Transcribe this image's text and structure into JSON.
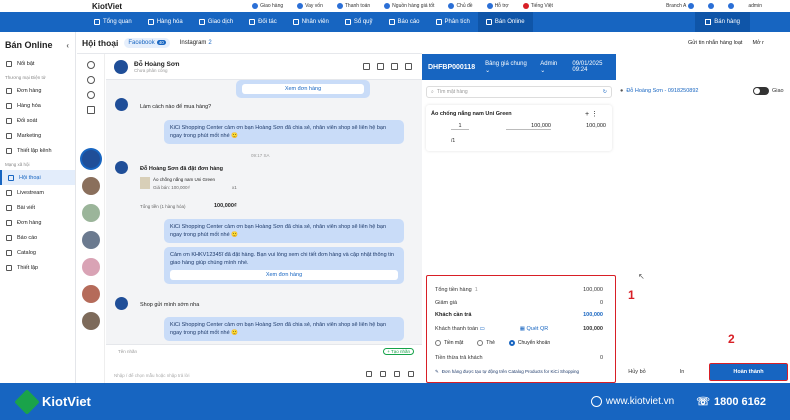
{
  "topbar": {
    "logo": "KiotViet",
    "items": [
      "Giao hàng",
      "Vay vốn",
      "Thanh toán",
      "Nguồn hàng giá tốt",
      "Chủ đề",
      "Hỗ trợ",
      "Tiếng Việt"
    ],
    "branch": "Branch A",
    "user": "admin"
  },
  "nav": {
    "items": [
      "Tổng quan",
      "Hàng hóa",
      "Giao dịch",
      "Đối tác",
      "Nhân viên",
      "Sổ quỹ",
      "Báo cáo",
      "Phân tích",
      "Bán Online"
    ],
    "sale": "Bán hàng"
  },
  "sidebar": {
    "title": "Bán Online",
    "featured": "Nổi bật",
    "sec1": "Thương mại Điện tử",
    "items1": [
      "Đơn hàng",
      "Hàng hóa",
      "Đối soát",
      "Marketing",
      "Thiết lập kênh"
    ],
    "sec2": "Mạng xã hội",
    "items2": [
      "Hội thoại",
      "Livestream",
      "Bài viết",
      "Đơn hàng",
      "Báo cáo",
      "Catalog",
      "Thiết lập"
    ]
  },
  "conv": {
    "title": "Hội thoại",
    "tab_fb": "Facebook",
    "tab_fb_count": "40",
    "tab_ig": "Instagram",
    "tab_ig_count": "2"
  },
  "chat": {
    "name": "Đỗ Hoàng Sơn",
    "sub": "Chưa phân công",
    "view_order": "Xem đơn hàng",
    "q1": "Làm cách nào để mua hàng?",
    "reply": "KiCi Shopping Center cảm ơn bạn Hoàng Sơn đã chia sẻ, nhân viên shop sẽ liên hệ bạn ngay trong phút mốt nhé 🙂",
    "time": "09:17 SA",
    "order_placed": "Đỗ Hoàng Sơn đã đặt đơn hàng",
    "prod_name": "Áo chống nắng nam Uni Green",
    "prod_price": "Giá bán: 100,000₫",
    "prod_qty": "x1",
    "order_total_lbl": "Tổng tiền (1 hàng hóa)",
    "order_total": "100,000₫",
    "reply2": "KiCi Shopping Center cảm ơn bạn Hoàng Sơn đã chia sẻ, nhân viên shop sẽ liên hệ bạn ngay trong phút mốt nhé 🙂",
    "confirm": "Cảm ơn KHKV12345ĩ đã đặt hàng. Bạn vui lòng xem chi tiết đơn hàng và cập nhật thông tin giao hàng giúp chúng mình nhé.",
    "view_order2": "Xem đơn hàng",
    "q2": "Shop gửi mình sớm nha",
    "reply3": "KiCi Shopping Center cảm ơn bạn Hoàng Sơn đã chia sẻ, nhân viên shop sẽ liên hệ bạn ngay trong phút mốt nhé 🙂",
    "tag_label": "Tên nhãn",
    "add_tag": "+ Tạo nhãn",
    "input_placeholder": "Nhập / để chọn mẫu hoặc nhập trả lời"
  },
  "order": {
    "code": "DHFBP000118",
    "price_list": "Bảng giá chung",
    "staff": "Admin",
    "datetime": "09/01/2025 09:24",
    "search_placeholder": "Tìm mặt hàng",
    "customer": "Đỗ Hoàng Sơn - 0918250892",
    "delivery": "Giao",
    "product": "Áo chống nắng nam Uni Green",
    "qty": "1",
    "unit": "/1",
    "price": "100,000",
    "total": "100,000"
  },
  "summary": {
    "rows": [
      {
        "label": "Tổng tiền hàng",
        "count": "1",
        "value": "100,000"
      },
      {
        "label": "Giảm giá",
        "value": "0"
      },
      {
        "label": "Khách cần trả",
        "value": "100,000"
      },
      {
        "label": "Khách thanh toán",
        "qr": "Quét QR",
        "value": "100,000"
      }
    ],
    "methods": [
      "Tiền mặt",
      "Thẻ",
      "Chuyển khoản"
    ],
    "change_label": "Tiền thừa trả khách",
    "change_value": "0",
    "note": "Đơn hàng được tạo tự động trên Catalog Products for KiCi Shopping"
  },
  "annotations": {
    "a1": "1",
    "a2": "2"
  },
  "actions": {
    "cancel": "Hủy bỏ",
    "print": "In",
    "done": "Hoàn thành"
  },
  "rightbar": {
    "auto": "Gửi tin nhắn hàng loạt",
    "open": "Mở r"
  },
  "footer": {
    "logo": "KiotViet",
    "web": "www.kiotviet.vn",
    "phone": "1800 6162"
  },
  "colors": {
    "brand": "#1765c1",
    "annotation": "#d81f26"
  }
}
